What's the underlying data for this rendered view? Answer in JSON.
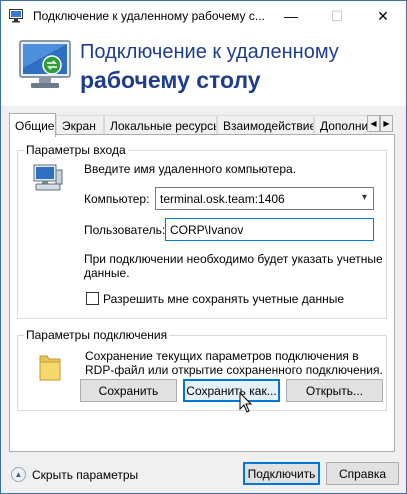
{
  "window": {
    "title": "Подключение к удаленному рабочему с...",
    "controls": {
      "minimize": "—",
      "maximize": "☐",
      "close": "✕"
    }
  },
  "header": {
    "line1": "Подключение к удаленному",
    "line2": "рабочему столу"
  },
  "tabs": [
    {
      "label": "Общие",
      "active": true
    },
    {
      "label": "Экран",
      "active": false
    },
    {
      "label": "Локальные ресурсы",
      "active": false
    },
    {
      "label": "Взаимодействие",
      "active": false
    },
    {
      "label": "Дополни",
      "active": false
    }
  ],
  "tab_scroll": {
    "left": "◀",
    "right": "▶"
  },
  "logon": {
    "group_title": "Параметры входа",
    "instruction": "Введите имя удаленного компьютера.",
    "computer_label": "Компьютер:",
    "computer_value": "terminal.osk.team:1406",
    "user_label": "Пользователь:",
    "user_value": "CORP\\Ivanov",
    "note_line1": "При подключении необходимо будет указать учетные",
    "note_line2": "данные.",
    "save_credentials_label": "Разрешить мне сохранять учетные данные",
    "save_credentials_checked": false
  },
  "connection": {
    "group_title": "Параметры подключения",
    "desc_line1": "Сохранение текущих параметров подключения в",
    "desc_line2": "RDP-файл или открытие сохраненного подключения.",
    "save_label": "Сохранить",
    "save_as_label": "Сохранить как...",
    "open_label": "Открыть..."
  },
  "footer": {
    "toggle_icon": "▲",
    "hide_options_label": "Скрыть параметры",
    "connect_label": "Подключить",
    "help_label": "Справка"
  },
  "colors": {
    "accent": "#0078d7",
    "header_text": "#1e3e8c"
  }
}
